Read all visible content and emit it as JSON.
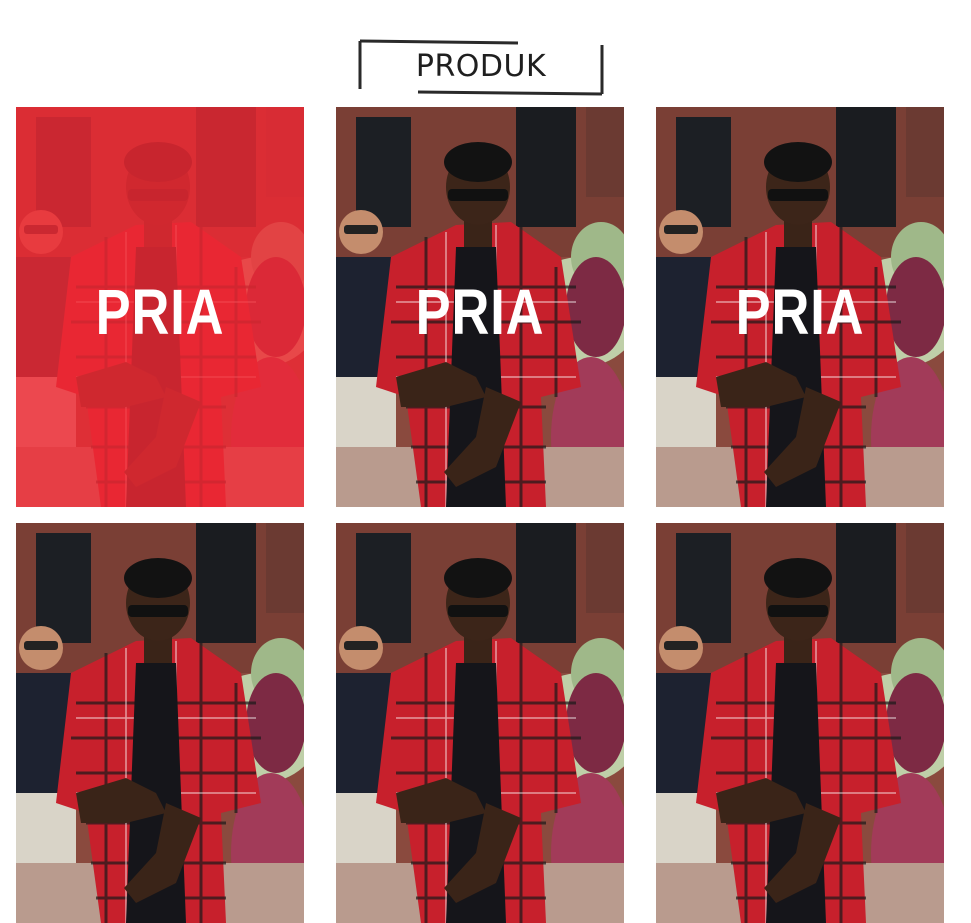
{
  "section": {
    "title": "PRODUK"
  },
  "products": [
    {
      "label": "PRIA",
      "highlighted": true
    },
    {
      "label": "PRIA",
      "highlighted": false
    },
    {
      "label": "PRIA",
      "highlighted": false
    },
    {
      "label": "",
      "highlighted": false
    },
    {
      "label": "",
      "highlighted": false
    },
    {
      "label": "",
      "highlighted": false
    }
  ],
  "colors": {
    "highlight": "#f02a35",
    "text": "#1f1f1f",
    "label": "#ffffff"
  }
}
